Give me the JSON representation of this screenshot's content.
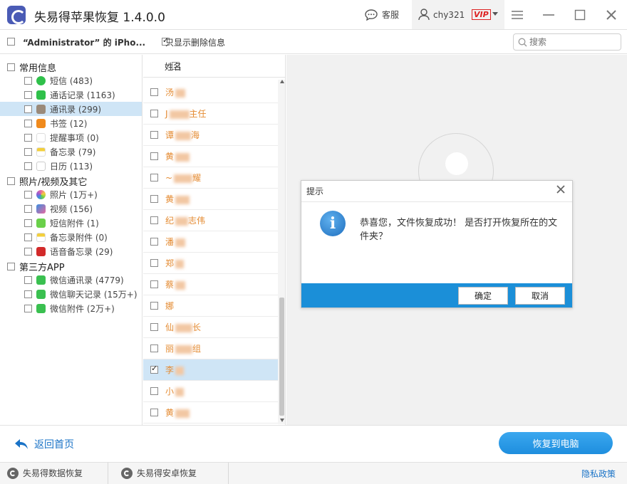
{
  "app": {
    "title": "失易得苹果恢复  1.4.0.0",
    "service_label": "客服",
    "user_name": "chy321",
    "vip_label": "VIP"
  },
  "toolbar": {
    "device_label": "“Administrator” 的 iPho...",
    "only_deleted_label": "只显示删除信息",
    "search_placeholder": "搜索"
  },
  "tree": {
    "groups": [
      {
        "label": "常用信息",
        "items": [
          {
            "label": "短信 (483)",
            "color": "#2fc04a"
          },
          {
            "label": "通话记录 (1163)",
            "color": "#2fc04a"
          },
          {
            "label": "通讯录 (299)",
            "color": "#9a8a7a"
          },
          {
            "label": "书签 (12)",
            "color": "#f08a1c"
          },
          {
            "label": "提醒事项 (0)",
            "color": "#dddddd"
          },
          {
            "label": "备忘录 (79)",
            "color": "#f3cf3c"
          },
          {
            "label": "日历 (113)",
            "color": "#eeeeee"
          }
        ]
      },
      {
        "label": "照片/视频及其它",
        "items": [
          {
            "label": "照片 (1万+)",
            "color": "#e86aa0"
          },
          {
            "label": "视频 (156)",
            "color": "#3a8ee0"
          },
          {
            "label": "短信附件 (1)",
            "color": "#6ad04a"
          },
          {
            "label": "备忘录附件 (0)",
            "color": "#f3cf3c"
          },
          {
            "label": "语音备忘录 (29)",
            "color": "#d22a2a"
          }
        ]
      },
      {
        "label": "第三方APP",
        "items": [
          {
            "label": "微信通讯录 (4779)",
            "color": "#3ac050"
          },
          {
            "label": "微信聊天记录 (15万+)",
            "color": "#3ac050"
          },
          {
            "label": "微信附件 (2万+)",
            "color": "#3ac050"
          }
        ]
      }
    ]
  },
  "list": {
    "header": "姓名",
    "rows": [
      {
        "prefix": "汤"
      },
      {
        "prefix": "J",
        "suffix": "主任"
      },
      {
        "prefix": "谭",
        "suffix": "海"
      },
      {
        "prefix": "黄"
      },
      {
        "prefix": "~",
        "suffix": "耀"
      },
      {
        "prefix": "黄"
      },
      {
        "prefix": "纪",
        "suffix": "志伟"
      },
      {
        "prefix": "潘"
      },
      {
        "prefix": "郑"
      },
      {
        "prefix": "蔡"
      },
      {
        "prefix": "娜"
      },
      {
        "prefix": "仙",
        "suffix": "长"
      },
      {
        "prefix": "丽",
        "suffix": "组"
      },
      {
        "prefix": "李"
      },
      {
        "prefix": "小"
      },
      {
        "prefix": "黄"
      }
    ]
  },
  "dialog": {
    "title": "提示",
    "message": "恭喜您，文件恢复成功！ 是否打开恢复所在的文件夹？",
    "ok_label": "确定",
    "cancel_label": "取消"
  },
  "bottom": {
    "back_label": "返回首页",
    "recover_label": "恢复到电脑"
  },
  "footer": {
    "data_recovery_label": "失易得数据恢复",
    "android_recovery_label": "失易得安卓恢复",
    "privacy_label": "隐私政策"
  },
  "colors": {
    "accent": "#1b8fd8",
    "name_orange": "#e48a30",
    "selected_row": "#cfe5f6"
  }
}
